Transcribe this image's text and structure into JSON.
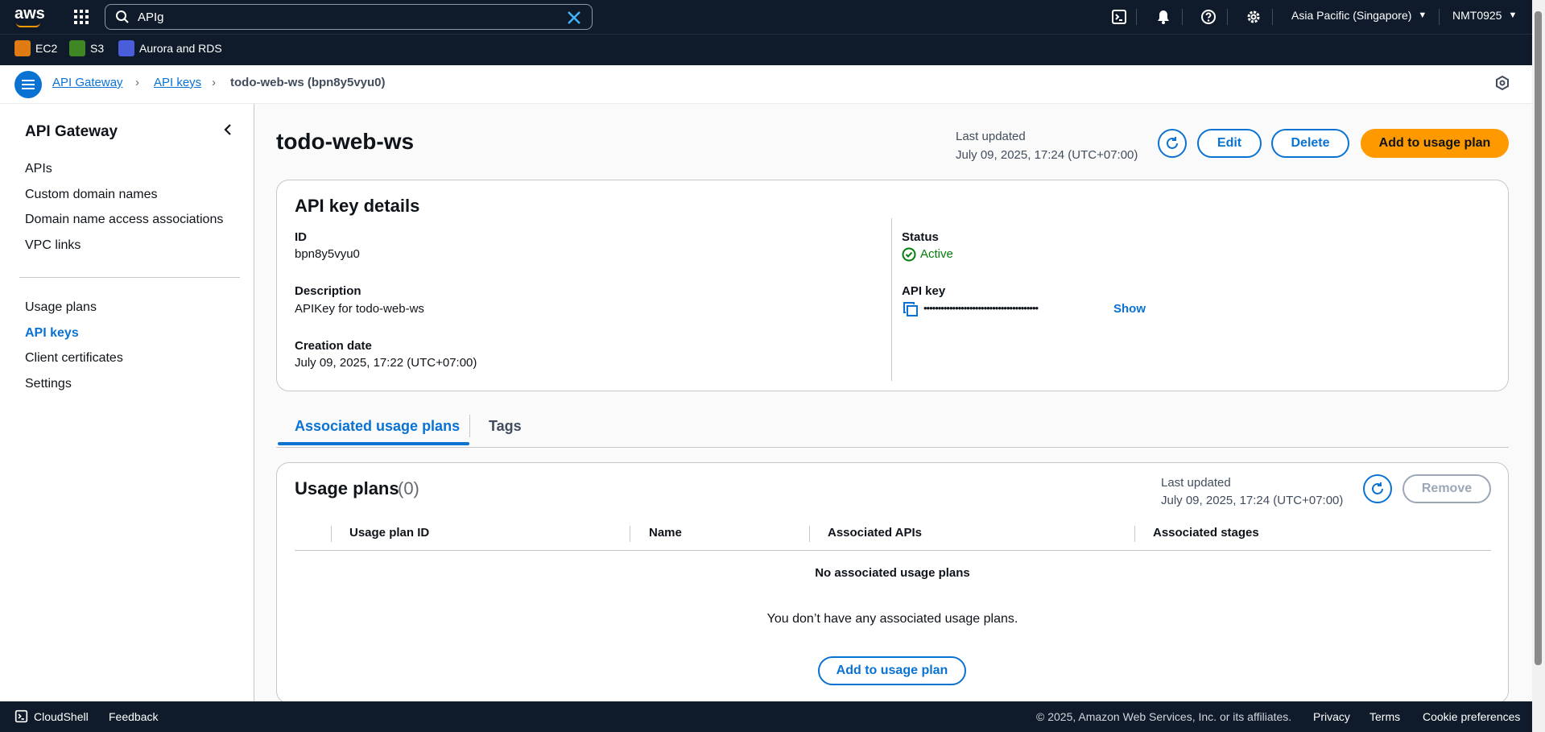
{
  "topnav": {
    "search_value": "APIg",
    "region": "Asia Pacific (Singapore)",
    "account": "NMT0925",
    "icons": [
      "aws-logo",
      "grid-icon",
      "search-icon",
      "clear-icon",
      "cloudshell-icon",
      "bell-icon",
      "help-icon",
      "gear-icon"
    ]
  },
  "favorites": [
    {
      "label": "EC2",
      "color": "#e07b14"
    },
    {
      "label": "S3",
      "color": "#3f8624"
    },
    {
      "label": "Aurora and RDS",
      "color": "#4a5ddb"
    }
  ],
  "breadcrumb": {
    "items": [
      "API Gateway",
      "API keys"
    ],
    "current": "todo-web-ws (bpn8y5vyu0)"
  },
  "sidenav": {
    "title": "API Gateway",
    "group1": [
      "APIs",
      "Custom domain names",
      "Domain name access associations",
      "VPC links"
    ],
    "group2": [
      "Usage plans",
      "API keys",
      "Client certificates",
      "Settings"
    ],
    "active": "API keys"
  },
  "header": {
    "title": "todo-web-ws",
    "last_updated_label": "Last updated",
    "last_updated_value": "July 09, 2025, 17:24 (UTC+07:00)",
    "edit": "Edit",
    "delete": "Delete",
    "add_usage_plan": "Add to usage plan"
  },
  "details": {
    "heading": "API key details",
    "id_label": "ID",
    "id_value": "bpn8y5vyu0",
    "description_label": "Description",
    "description_value": "APIKey for todo-web-ws",
    "creation_label": "Creation date",
    "creation_value": "July 09, 2025, 17:22 (UTC+07:00)",
    "status_label": "Status",
    "status_value": "Active",
    "apikey_label": "API key",
    "apikey_mask": "••••••••••••••••••••••••••••••••••••••••",
    "show": "Show"
  },
  "tabs": [
    "Associated usage plans",
    "Tags"
  ],
  "usage_plans": {
    "heading": "Usage plans",
    "count": "(0)",
    "last_updated_label": "Last updated",
    "last_updated_value": "July 09, 2025, 17:24 (UTC+07:00)",
    "remove": "Remove",
    "columns": [
      "Usage plan ID",
      "Name",
      "Associated APIs",
      "Associated stages"
    ],
    "empty_title": "No associated usage plans",
    "empty_text": "You don’t have any associated usage plans.",
    "empty_button": "Add to usage plan"
  },
  "footer": {
    "cloudshell": "CloudShell",
    "feedback": "Feedback",
    "copyright": "© 2025, Amazon Web Services, Inc. or its affiliates.",
    "privacy": "Privacy",
    "terms": "Terms",
    "cookies": "Cookie preferences"
  }
}
